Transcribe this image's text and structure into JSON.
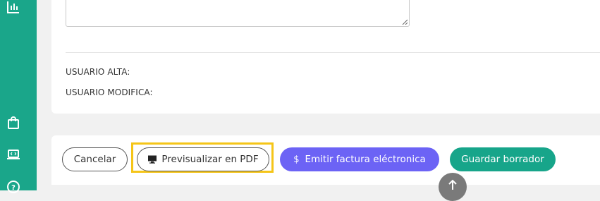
{
  "sidebar": {
    "icons": [
      "bar-chart-icon",
      "shopping-bag-icon",
      "laptop-code-icon",
      "help-circle-icon"
    ]
  },
  "form": {
    "usuario_alta_label": "USUARIO ALTA:",
    "usuario_modifica_label": "USUARIO MODIFICA:"
  },
  "actions": {
    "cancel_label": "Cancelar",
    "preview_label": "Previsualizar en PDF",
    "emit_label": "Emitir factura eléctronica",
    "save_label": "Guardar borrador"
  },
  "colors": {
    "sidebar": "#1aa68a",
    "emit_button": "#6c63f5",
    "save_button": "#17a58a",
    "highlight": "#f5c518"
  }
}
